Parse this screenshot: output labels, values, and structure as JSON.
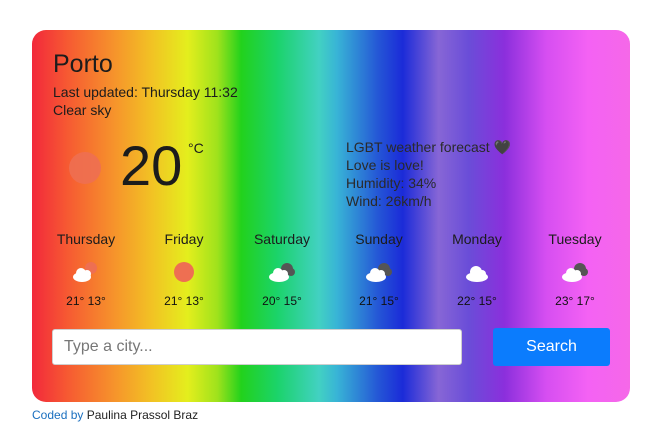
{
  "weather": {
    "city": "Porto",
    "last_updated": "Last updated: Thursday 11:32",
    "description": "Clear sky",
    "current_icon": "sun-icon",
    "temperature": "20",
    "unit": "°C",
    "info": {
      "title": "LGBT weather forecast 🖤",
      "slogan": "Love is love!",
      "humidity": "Humidity: 34%",
      "wind": "Wind: 26km/h"
    }
  },
  "forecast": [
    {
      "day": "Thursday",
      "icon": "sun-cloud-icon",
      "temps": "21° 13°"
    },
    {
      "day": "Friday",
      "icon": "sun-icon",
      "temps": "21° 13°"
    },
    {
      "day": "Saturday",
      "icon": "broken-clouds-icon",
      "temps": "20° 15°"
    },
    {
      "day": "Sunday",
      "icon": "broken-clouds-icon",
      "temps": "21° 15°"
    },
    {
      "day": "Monday",
      "icon": "cloud-icon",
      "temps": "22° 15°"
    },
    {
      "day": "Tuesday",
      "icon": "broken-clouds-icon",
      "temps": "23° 17°"
    }
  ],
  "search": {
    "placeholder": "Type a city...",
    "value": "",
    "button_label": "Search"
  },
  "footer": {
    "link_text": "Coded by",
    "author": "Paulina Prassol Braz"
  },
  "colors": {
    "button": "#0b7cfd",
    "sun": "#ee6f52"
  }
}
